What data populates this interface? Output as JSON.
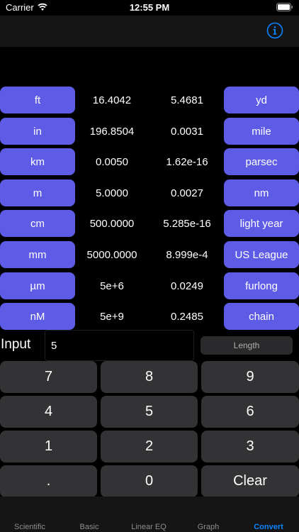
{
  "status": {
    "carrier": "Carrier",
    "time": "12:55 PM"
  },
  "units_left": [
    {
      "label": "ft",
      "value": "16.4042"
    },
    {
      "label": "in",
      "value": "196.8504"
    },
    {
      "label": "km",
      "value": "0.0050"
    },
    {
      "label": "m",
      "value": "5.0000"
    },
    {
      "label": "cm",
      "value": "500.0000"
    },
    {
      "label": "mm",
      "value": "5000.0000"
    },
    {
      "label": "µm",
      "value": "5e+6"
    },
    {
      "label": "nM",
      "value": "5e+9"
    }
  ],
  "units_right": [
    {
      "label": "yd",
      "value": "5.4681"
    },
    {
      "label": "mile",
      "value": "0.0031"
    },
    {
      "label": "parsec",
      "value": "1.62e-16"
    },
    {
      "label": "nm",
      "value": "0.0027"
    },
    {
      "label": "light year",
      "value": "5.285e-16"
    },
    {
      "label": "US League",
      "value": "8.999e-4"
    },
    {
      "label": "furlong",
      "value": "0.0249"
    },
    {
      "label": "chain",
      "value": "0.2485"
    }
  ],
  "input": {
    "label": "Input",
    "value": "5",
    "type_label": "Length"
  },
  "keypad": [
    "7",
    "8",
    "9",
    "4",
    "5",
    "6",
    "1",
    "2",
    "3",
    ".",
    "0",
    "Clear"
  ],
  "tabs": [
    "Scientific",
    "Basic",
    "Linear EQ",
    "Graph",
    "Convert"
  ],
  "colors": {
    "accent": "#5e5ce6",
    "active_tab": "#0a84ff",
    "key_bg": "#333335"
  }
}
